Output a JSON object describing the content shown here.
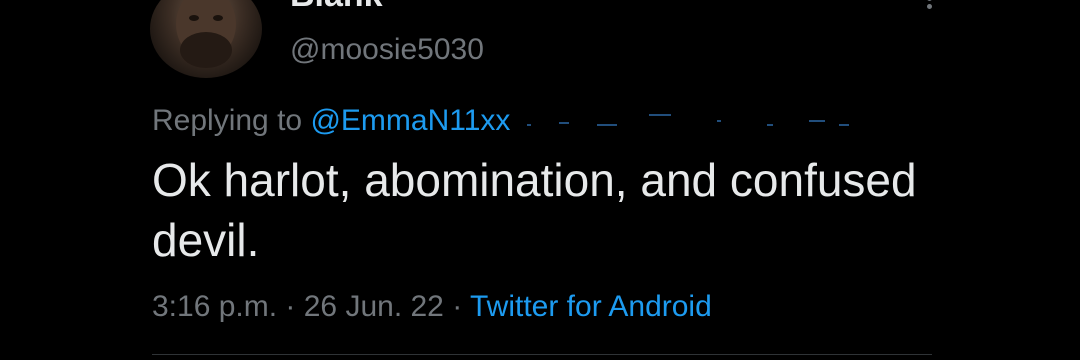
{
  "tweet": {
    "display_name": "Blank",
    "handle": "@moosie5030",
    "replying_prefix": "Replying to",
    "replying_mention": "@EmmaN11xx",
    "text": "Ok harlot, abomination, and confused devil.",
    "time": "3:16 p.m.",
    "separator": " · ",
    "date": "26 Jun. 22",
    "source": "Twitter for Android"
  },
  "colors": {
    "background": "#000000",
    "primary_text": "#e7e9ea",
    "secondary_text": "#71767b",
    "link": "#1d9bf0",
    "divider": "#2f3336"
  },
  "icons": {
    "more": "more-vertical-icon"
  }
}
